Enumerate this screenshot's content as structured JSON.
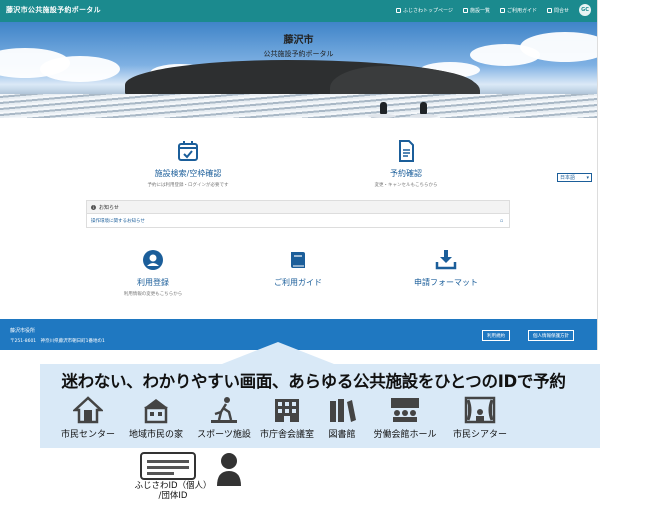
{
  "header": {
    "title": "藤沢市公共施設予約ポータル",
    "nav": [
      {
        "label": "ふじさわトップページ",
        "icon": "home-icon"
      },
      {
        "label": "施設一覧",
        "icon": "list-icon"
      },
      {
        "label": "ご利用ガイド",
        "icon": "book-icon"
      },
      {
        "label": "問合せ",
        "icon": "mail-icon"
      }
    ],
    "avatar": "GC"
  },
  "hero": {
    "city": "藤沢市",
    "subtitle": "公共施設予約ポータル"
  },
  "tiles": [
    {
      "label": "施設検索/空枠確認",
      "sub": "予約には利用登録・ログインが必要です",
      "icon": "calendar-check-icon"
    },
    {
      "label": "予約確認",
      "sub": "変更・キャンセルもこちらから",
      "icon": "document-icon"
    },
    {
      "label": "利用登録",
      "sub": "利用情報の変更もこちらから",
      "icon": "user-icon"
    },
    {
      "label": "ご利用ガイド",
      "sub": "",
      "icon": "book-icon"
    },
    {
      "label": "申請フォーマット",
      "sub": "",
      "icon": "download-icon"
    }
  ],
  "language": {
    "selected": "日本語"
  },
  "notice": {
    "title": "お知らせ",
    "item": "操作環境に関するお知らせ"
  },
  "footer": {
    "name": "藤沢市役所",
    "address": "〒251-8601　神奈川県藤沢市朝日町1番地の1",
    "buttons": [
      "利用規約",
      "個人情報保護方針"
    ]
  },
  "overlay": {
    "tagline": "迷わない、わかりやすい画面、あらゆる公共施設をひとつのIDで予約",
    "facilities": [
      {
        "label": "市民センター",
        "icon": "civic-center-icon"
      },
      {
        "label": "地域市民の家",
        "icon": "community-house-icon"
      },
      {
        "label": "スポーツ施設",
        "icon": "sports-facility-icon"
      },
      {
        "label": "市庁舎会議室",
        "icon": "city-hall-icon"
      },
      {
        "label": "図書館",
        "icon": "library-icon"
      },
      {
        "label": "労働会館ホール",
        "icon": "hall-icon"
      },
      {
        "label": "市民シアター",
        "icon": "theater-icon"
      }
    ],
    "id_label_line1": "ふじさわID（個人）",
    "id_label_line2": "/団体ID"
  },
  "colors": {
    "header": "#1b8a8e",
    "footer": "#1f78c1",
    "link": "#1b5e9a",
    "panel": "#d9e9f7"
  }
}
